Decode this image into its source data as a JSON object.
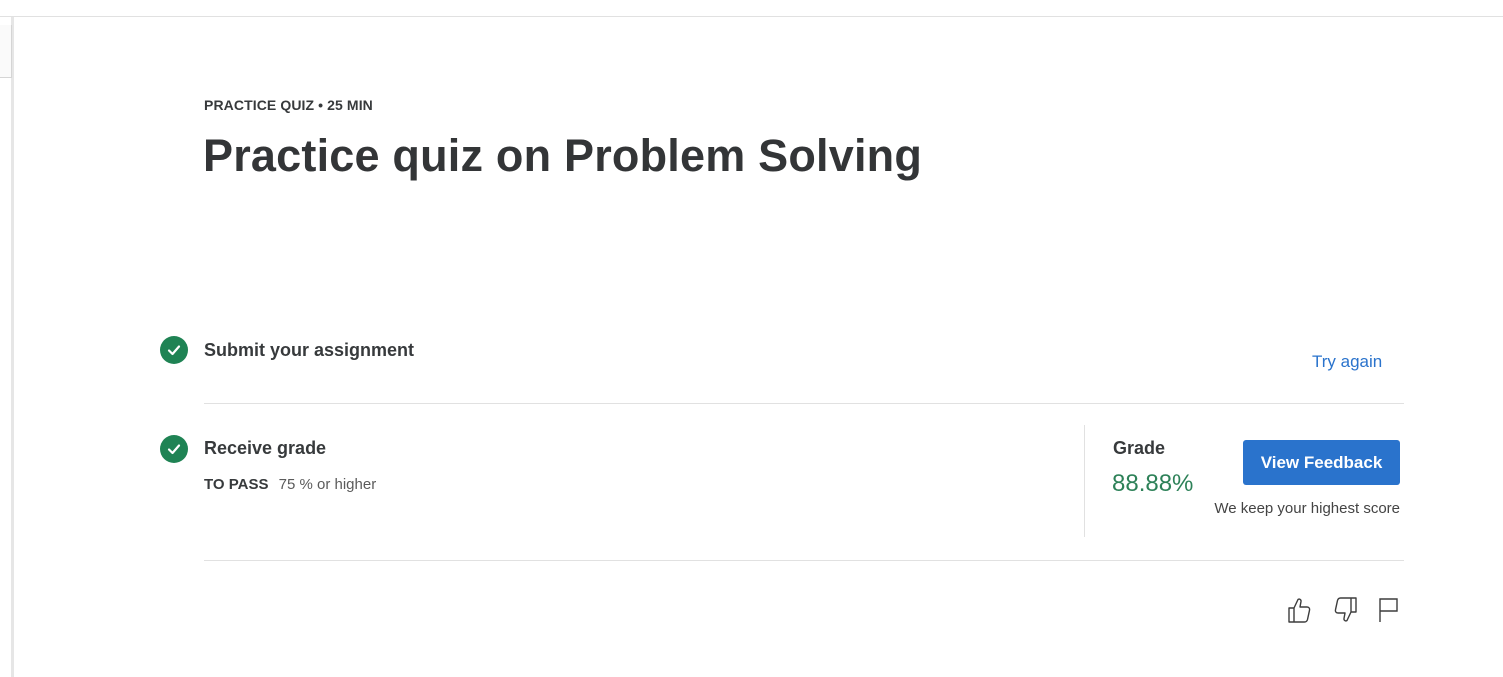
{
  "header": {
    "eyebrow": "PRACTICE QUIZ • 25 MIN",
    "title": "Practice quiz on Problem Solving"
  },
  "steps": {
    "submit": {
      "title": "Submit your assignment",
      "action_label": "Try again",
      "status_icon": "check-circle-icon"
    },
    "grade": {
      "title": "Receive grade",
      "to_pass_label": "TO PASS",
      "to_pass_value": "75 % or higher",
      "status_icon": "check-circle-icon"
    }
  },
  "grade_panel": {
    "label": "Grade",
    "value": "88.88%",
    "button_label": "View Feedback",
    "note": "We keep your highest score"
  },
  "feedback_icons": [
    "thumbs-up-icon",
    "thumbs-down-icon",
    "flag-icon"
  ],
  "colors": {
    "accent": "#2a73cc",
    "success": "#1f8354",
    "grade_text": "#2d8158"
  }
}
